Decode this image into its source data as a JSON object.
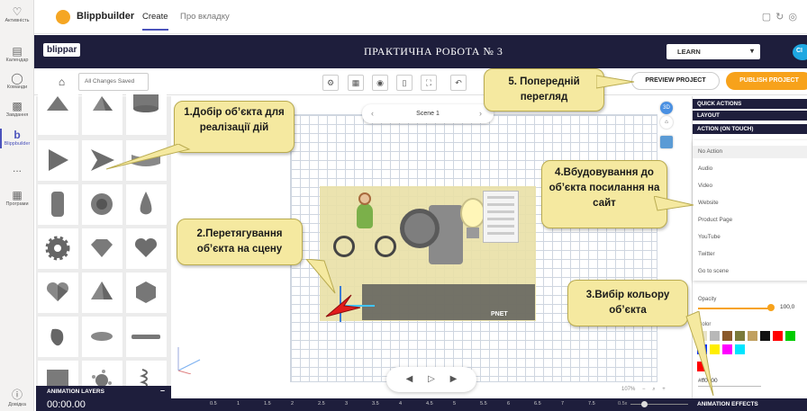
{
  "rail": {
    "items": [
      {
        "label": "Активність",
        "icon": "bell-icon"
      },
      {
        "label": "Календар",
        "icon": "calendar-icon"
      },
      {
        "label": "Команди",
        "icon": "teams-icon"
      },
      {
        "label": "Завдання",
        "icon": "assignments-icon"
      },
      {
        "label": "Blippbuilder",
        "icon": "blippbuilder-icon"
      },
      {
        "label": "...",
        "icon": "more-icon"
      },
      {
        "label": "Програми",
        "icon": "apps-icon"
      }
    ],
    "help_label": "Довідка"
  },
  "teams_tab": {
    "app_name": "Blippbuilder",
    "tab_create": "Create",
    "tab_about": "Про вкладку"
  },
  "header": {
    "logo": "blippar",
    "title": "ПРАКТИЧНА РОБОТА № 3",
    "mode": "LEARN",
    "avatar": "CI"
  },
  "toolbar": {
    "status": "All Changes Saved",
    "preview_label": "PREVIEW PROJECT",
    "publish_label": "PUBLISH PROJECT"
  },
  "scene": {
    "name": "Scene 1"
  },
  "right_panel": {
    "quick_actions": "QUICK ACTIONS",
    "layout": "LAYOUT",
    "action_header": "ACTION (ON TOUCH)",
    "actions": [
      "No Action",
      "Audio",
      "Video",
      "Website",
      "Product Page",
      "YouTube",
      "Twitter",
      "Go to scene"
    ],
    "selected_action": "No Action",
    "opacity_label": "Opacity",
    "opacity_value": "100,0",
    "color_label": "Color",
    "swatches": [
      "#e8e3c8",
      "#b8b8b8",
      "#8b5a2b",
      "#7a7a3a",
      "#c0a060",
      "#111111",
      "#ff0000",
      "#00cc00",
      "#0033ff",
      "#ffee00",
      "#ff00ff",
      "#00e5ff"
    ],
    "selected_color": "#ff0000",
    "hex_value": "#ff0000",
    "animation_effects": "ANIMATION EFFECTS"
  },
  "timeline": {
    "layers_header": "ANIMATION LAYERS",
    "time": "00:00.00",
    "ticks": [
      "0.5",
      "1",
      "1.5",
      "2",
      "2.5",
      "3",
      "3.5",
      "4",
      "4.5",
      "5",
      "5.5",
      "6",
      "6.5",
      "7",
      "7.5"
    ],
    "zoom_label": "0.5x"
  },
  "zoom": {
    "value": "107%"
  },
  "canvas_text": {
    "pitch": "PNET"
  },
  "callouts": {
    "c1": "1.Добір об’єкта для реалізації дій",
    "c2": "2.Перетягування об’єкта на сцену",
    "c3": "3.Вибір кольору об’єкта",
    "c4": "4.Вбудовування до об’єкта посилання на сайт",
    "c5": "5. Попередній перегляд"
  },
  "colors": {
    "brand_dark": "#1e1e3c",
    "accent_orange": "#f7a21b",
    "callout_fill": "#f5e9a0",
    "teams_purple": "#4b53bc"
  }
}
